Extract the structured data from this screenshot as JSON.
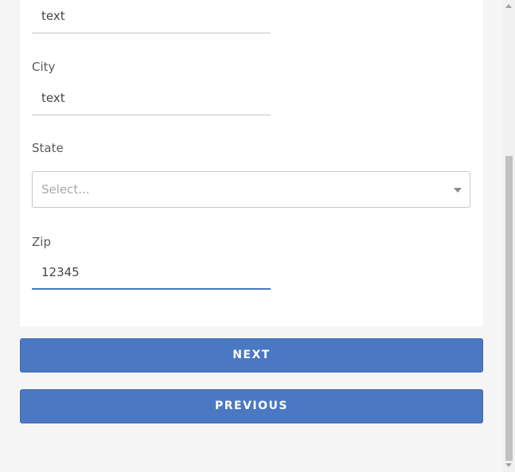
{
  "form": {
    "address_value": "text",
    "city_label": "City",
    "city_value": "text",
    "state_label": "State",
    "state_placeholder": "Select...",
    "zip_label": "Zip",
    "zip_value": "12345"
  },
  "buttons": {
    "next_label": "NEXT",
    "previous_label": "PREVIOUS"
  },
  "colors": {
    "primary": "#4b78c2",
    "page_background": "#f5f5f5",
    "card_background": "#ffffff",
    "active_underline": "#4a78c2"
  },
  "icons": {
    "select_caret": "chevron-down-icon",
    "scroll_up": "arrow-up-icon",
    "scroll_down": "arrow-down-icon"
  }
}
